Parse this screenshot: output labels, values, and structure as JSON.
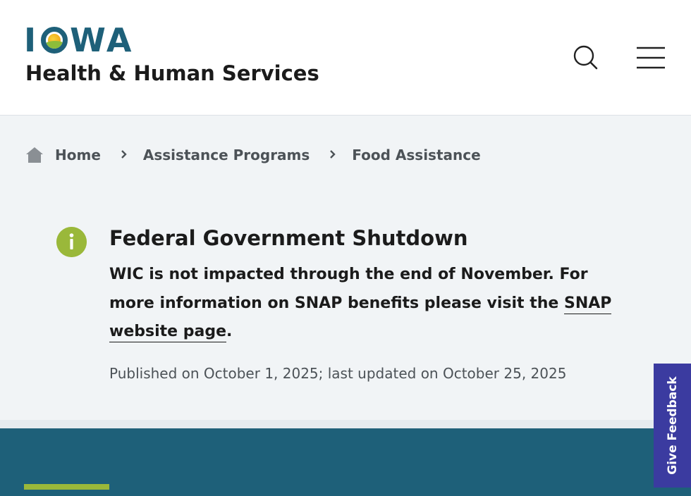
{
  "header": {
    "logo_letters": [
      "I",
      "W",
      "A"
    ],
    "logo_word": "IOWA",
    "department": "Health & Human Services",
    "search_icon": "search-icon",
    "menu_icon": "hamburger-menu-icon"
  },
  "breadcrumb": {
    "home_icon": "home-icon",
    "items": [
      "Home",
      "Assistance Programs",
      "Food Assistance"
    ],
    "separator_icon": "chevron-right-icon"
  },
  "alert": {
    "icon": "info-icon",
    "title": "Federal Government Shutdown",
    "body_text": "WIC is not impacted through the end of November. For more information on SNAP benefits please visit the ",
    "link_text": "SNAP website page",
    "trailing_text": ".",
    "published": "Published on October 1, 2025; last updated on October 25, 2025"
  },
  "feedback": {
    "label": "Give Feedback"
  },
  "colors": {
    "brand_teal": "#1e6079",
    "accent_green": "#9ab83a",
    "sun_yellow": "#f2b01e",
    "feedback_purple": "#3b3ba0",
    "page_bg": "#f1f4f6"
  }
}
